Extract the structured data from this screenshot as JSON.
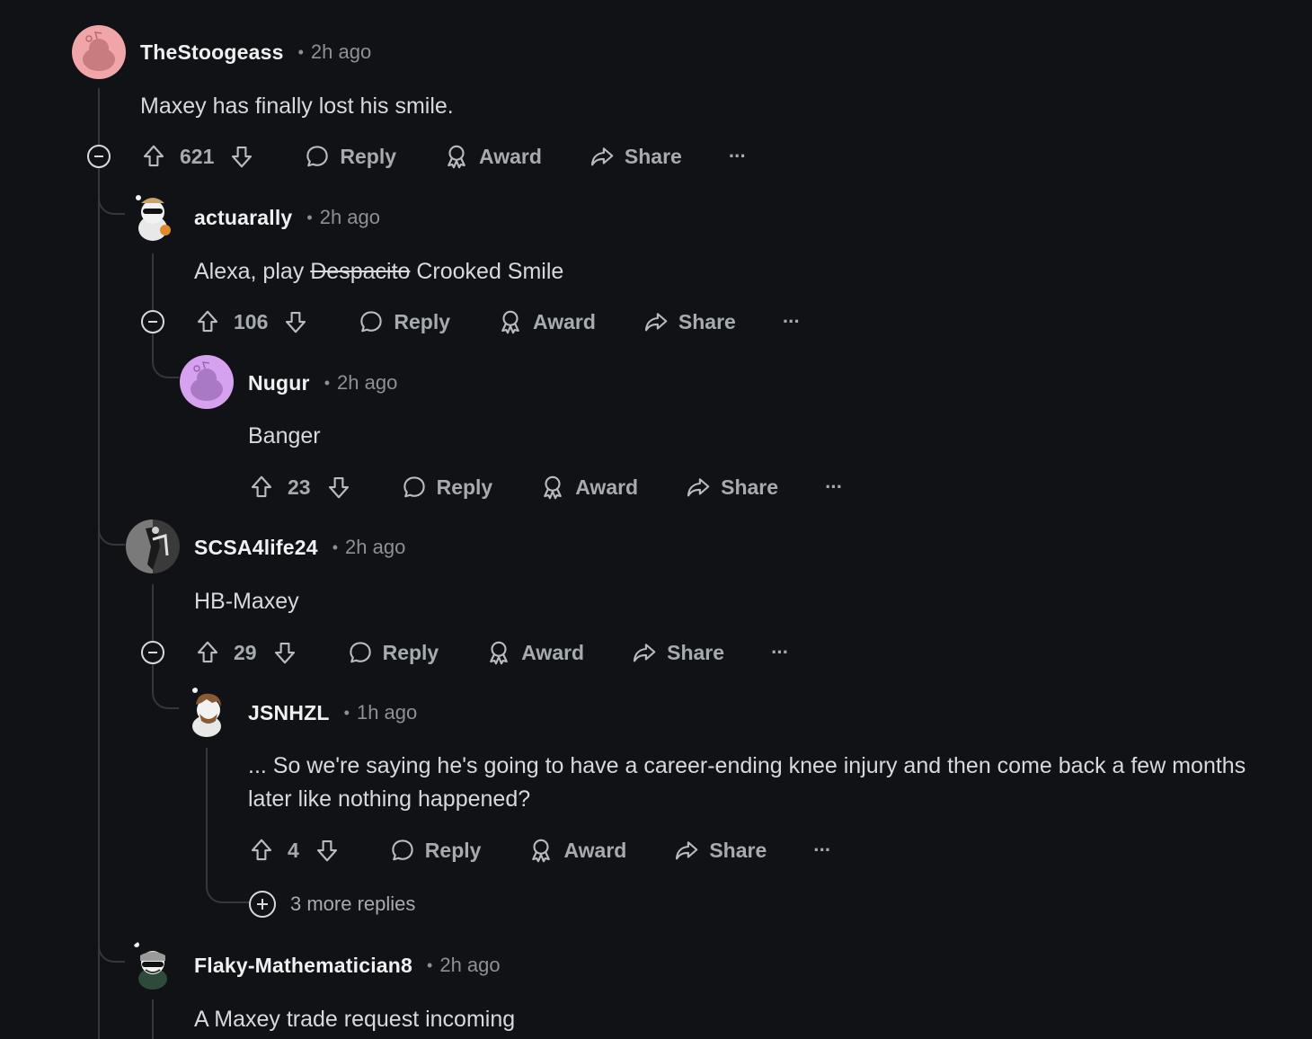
{
  "labels": {
    "reply": "Reply",
    "award": "Award",
    "share": "Share",
    "more": "···"
  },
  "colors": {
    "background": "#111215",
    "thread_line": "#34373c",
    "text": "#d7dadc",
    "muted": "#8c9195"
  },
  "comments": [
    {
      "user": "TheStoogeass",
      "time": "2h ago",
      "text": "Maxey has finally lost his smile.",
      "votes": "621",
      "avatar_color": "#f0a5a8"
    },
    {
      "user": "actuarally",
      "time": "2h ago",
      "text_prefix": "Alexa, play ",
      "text_struck": "Despacito",
      "text_suffix": " Crooked Smile",
      "votes": "106"
    },
    {
      "user": "Nugur",
      "time": "2h ago",
      "text": "Banger",
      "votes": "23",
      "avatar_color": "#d6a2f0"
    },
    {
      "user": "SCSA4life24",
      "time": "2h ago",
      "text": "HB-Maxey",
      "votes": "29"
    },
    {
      "user": "JSNHZL",
      "time": "1h ago",
      "text": "... So we're saying he's going to have a career-ending knee injury and then come back a few months later like nothing happened?",
      "votes": "4",
      "more_replies": "3 more replies"
    },
    {
      "user": "Flaky-Mathematician8",
      "time": "2h ago",
      "text": "A Maxey trade request incoming"
    }
  ]
}
